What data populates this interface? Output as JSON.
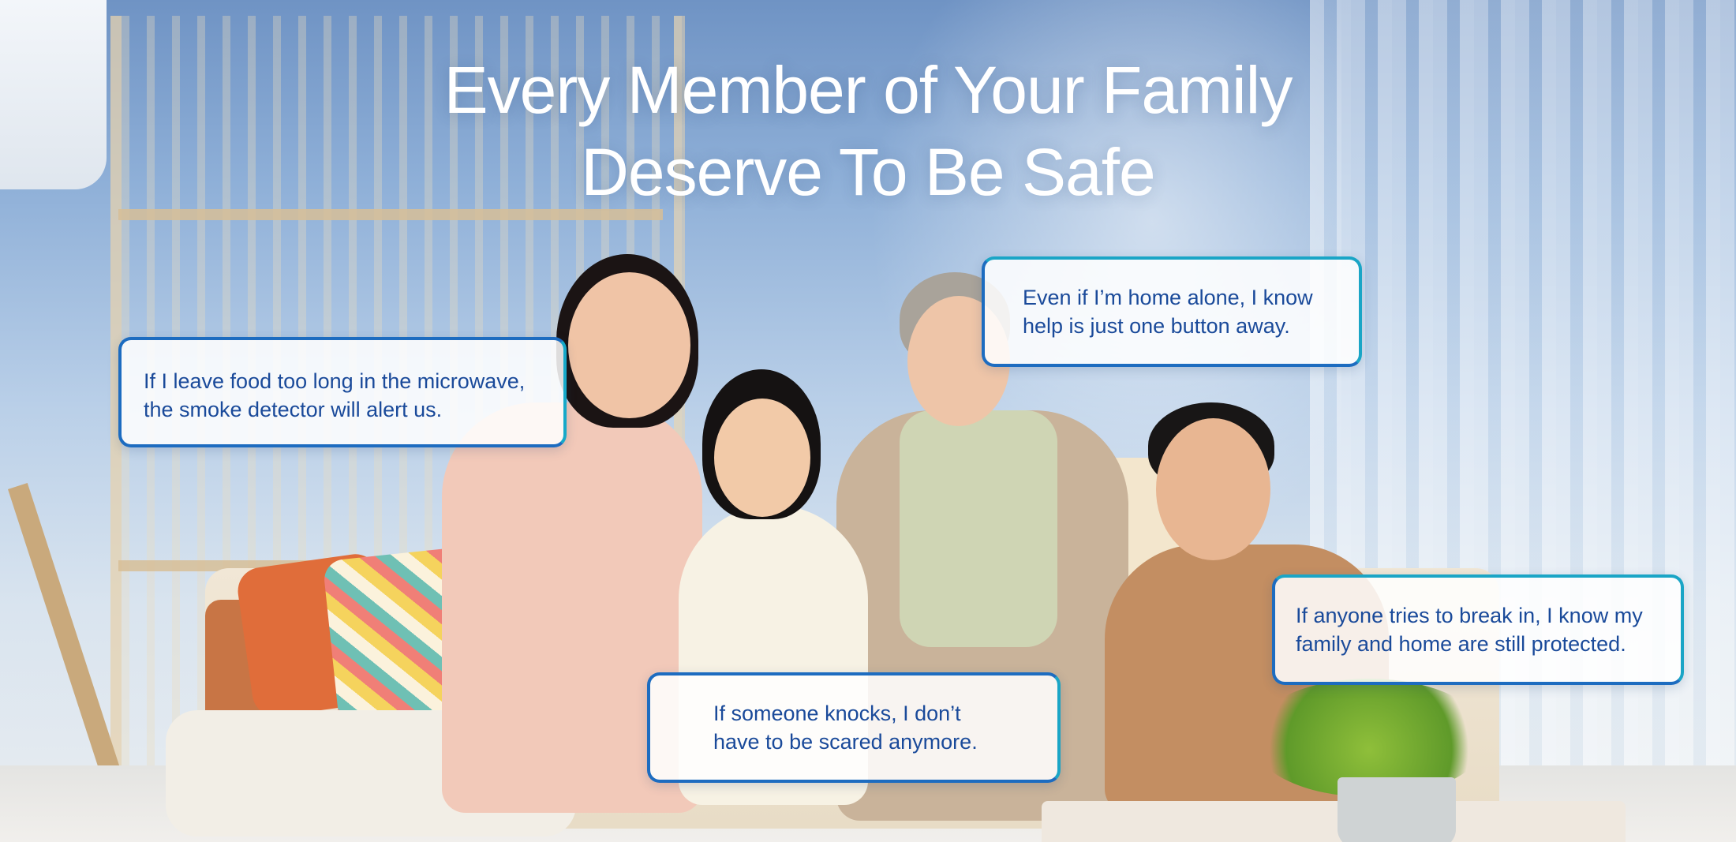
{
  "hero": {
    "headline_line1": "Every Member of Your Family",
    "headline_line2": "Deserve To Be Safe"
  },
  "testimonials": [
    {
      "line1": "If I leave food too long in the microwave,",
      "line2": "the smoke detector will alert us."
    },
    {
      "line1": "Even if I’m home alone, I know",
      "line2": "help is just one button away."
    },
    {
      "line1": "If anyone tries to break in, I know my",
      "line2": "family and home are still protected."
    },
    {
      "line1": "If someone knocks, I don’t",
      "line2": "have to be scared anymore."
    }
  ],
  "colors": {
    "headline_text": "#ffffff",
    "bubble_text": "#1a4a9a",
    "bubble_border_blue": "#1d6cc0",
    "bubble_border_teal": "#1aa5c6"
  }
}
